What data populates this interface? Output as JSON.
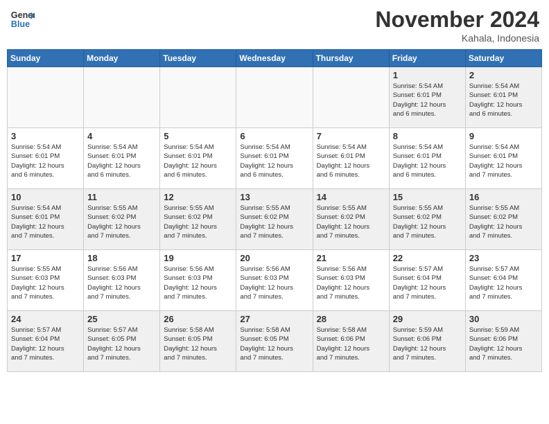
{
  "header": {
    "logo_line1": "General",
    "logo_line2": "Blue",
    "month_title": "November 2024",
    "location": "Kahala, Indonesia"
  },
  "weekdays": [
    "Sunday",
    "Monday",
    "Tuesday",
    "Wednesday",
    "Thursday",
    "Friday",
    "Saturday"
  ],
  "weeks": [
    [
      {
        "day": "",
        "info": "",
        "empty": true
      },
      {
        "day": "",
        "info": "",
        "empty": true
      },
      {
        "day": "",
        "info": "",
        "empty": true
      },
      {
        "day": "",
        "info": "",
        "empty": true
      },
      {
        "day": "",
        "info": "",
        "empty": true
      },
      {
        "day": "1",
        "info": "Sunrise: 5:54 AM\nSunset: 6:01 PM\nDaylight: 12 hours\nand 6 minutes."
      },
      {
        "day": "2",
        "info": "Sunrise: 5:54 AM\nSunset: 6:01 PM\nDaylight: 12 hours\nand 6 minutes."
      }
    ],
    [
      {
        "day": "3",
        "info": "Sunrise: 5:54 AM\nSunset: 6:01 PM\nDaylight: 12 hours\nand 6 minutes."
      },
      {
        "day": "4",
        "info": "Sunrise: 5:54 AM\nSunset: 6:01 PM\nDaylight: 12 hours\nand 6 minutes."
      },
      {
        "day": "5",
        "info": "Sunrise: 5:54 AM\nSunset: 6:01 PM\nDaylight: 12 hours\nand 6 minutes."
      },
      {
        "day": "6",
        "info": "Sunrise: 5:54 AM\nSunset: 6:01 PM\nDaylight: 12 hours\nand 6 minutes."
      },
      {
        "day": "7",
        "info": "Sunrise: 5:54 AM\nSunset: 6:01 PM\nDaylight: 12 hours\nand 6 minutes."
      },
      {
        "day": "8",
        "info": "Sunrise: 5:54 AM\nSunset: 6:01 PM\nDaylight: 12 hours\nand 6 minutes."
      },
      {
        "day": "9",
        "info": "Sunrise: 5:54 AM\nSunset: 6:01 PM\nDaylight: 12 hours\nand 7 minutes."
      }
    ],
    [
      {
        "day": "10",
        "info": "Sunrise: 5:54 AM\nSunset: 6:01 PM\nDaylight: 12 hours\nand 7 minutes."
      },
      {
        "day": "11",
        "info": "Sunrise: 5:55 AM\nSunset: 6:02 PM\nDaylight: 12 hours\nand 7 minutes."
      },
      {
        "day": "12",
        "info": "Sunrise: 5:55 AM\nSunset: 6:02 PM\nDaylight: 12 hours\nand 7 minutes."
      },
      {
        "day": "13",
        "info": "Sunrise: 5:55 AM\nSunset: 6:02 PM\nDaylight: 12 hours\nand 7 minutes."
      },
      {
        "day": "14",
        "info": "Sunrise: 5:55 AM\nSunset: 6:02 PM\nDaylight: 12 hours\nand 7 minutes."
      },
      {
        "day": "15",
        "info": "Sunrise: 5:55 AM\nSunset: 6:02 PM\nDaylight: 12 hours\nand 7 minutes."
      },
      {
        "day": "16",
        "info": "Sunrise: 5:55 AM\nSunset: 6:02 PM\nDaylight: 12 hours\nand 7 minutes."
      }
    ],
    [
      {
        "day": "17",
        "info": "Sunrise: 5:55 AM\nSunset: 6:03 PM\nDaylight: 12 hours\nand 7 minutes."
      },
      {
        "day": "18",
        "info": "Sunrise: 5:56 AM\nSunset: 6:03 PM\nDaylight: 12 hours\nand 7 minutes."
      },
      {
        "day": "19",
        "info": "Sunrise: 5:56 AM\nSunset: 6:03 PM\nDaylight: 12 hours\nand 7 minutes."
      },
      {
        "day": "20",
        "info": "Sunrise: 5:56 AM\nSunset: 6:03 PM\nDaylight: 12 hours\nand 7 minutes."
      },
      {
        "day": "21",
        "info": "Sunrise: 5:56 AM\nSunset: 6:03 PM\nDaylight: 12 hours\nand 7 minutes."
      },
      {
        "day": "22",
        "info": "Sunrise: 5:57 AM\nSunset: 6:04 PM\nDaylight: 12 hours\nand 7 minutes."
      },
      {
        "day": "23",
        "info": "Sunrise: 5:57 AM\nSunset: 6:04 PM\nDaylight: 12 hours\nand 7 minutes."
      }
    ],
    [
      {
        "day": "24",
        "info": "Sunrise: 5:57 AM\nSunset: 6:04 PM\nDaylight: 12 hours\nand 7 minutes."
      },
      {
        "day": "25",
        "info": "Sunrise: 5:57 AM\nSunset: 6:05 PM\nDaylight: 12 hours\nand 7 minutes."
      },
      {
        "day": "26",
        "info": "Sunrise: 5:58 AM\nSunset: 6:05 PM\nDaylight: 12 hours\nand 7 minutes."
      },
      {
        "day": "27",
        "info": "Sunrise: 5:58 AM\nSunset: 6:05 PM\nDaylight: 12 hours\nand 7 minutes."
      },
      {
        "day": "28",
        "info": "Sunrise: 5:58 AM\nSunset: 6:06 PM\nDaylight: 12 hours\nand 7 minutes."
      },
      {
        "day": "29",
        "info": "Sunrise: 5:59 AM\nSunset: 6:06 PM\nDaylight: 12 hours\nand 7 minutes."
      },
      {
        "day": "30",
        "info": "Sunrise: 5:59 AM\nSunset: 6:06 PM\nDaylight: 12 hours\nand 7 minutes."
      }
    ]
  ]
}
